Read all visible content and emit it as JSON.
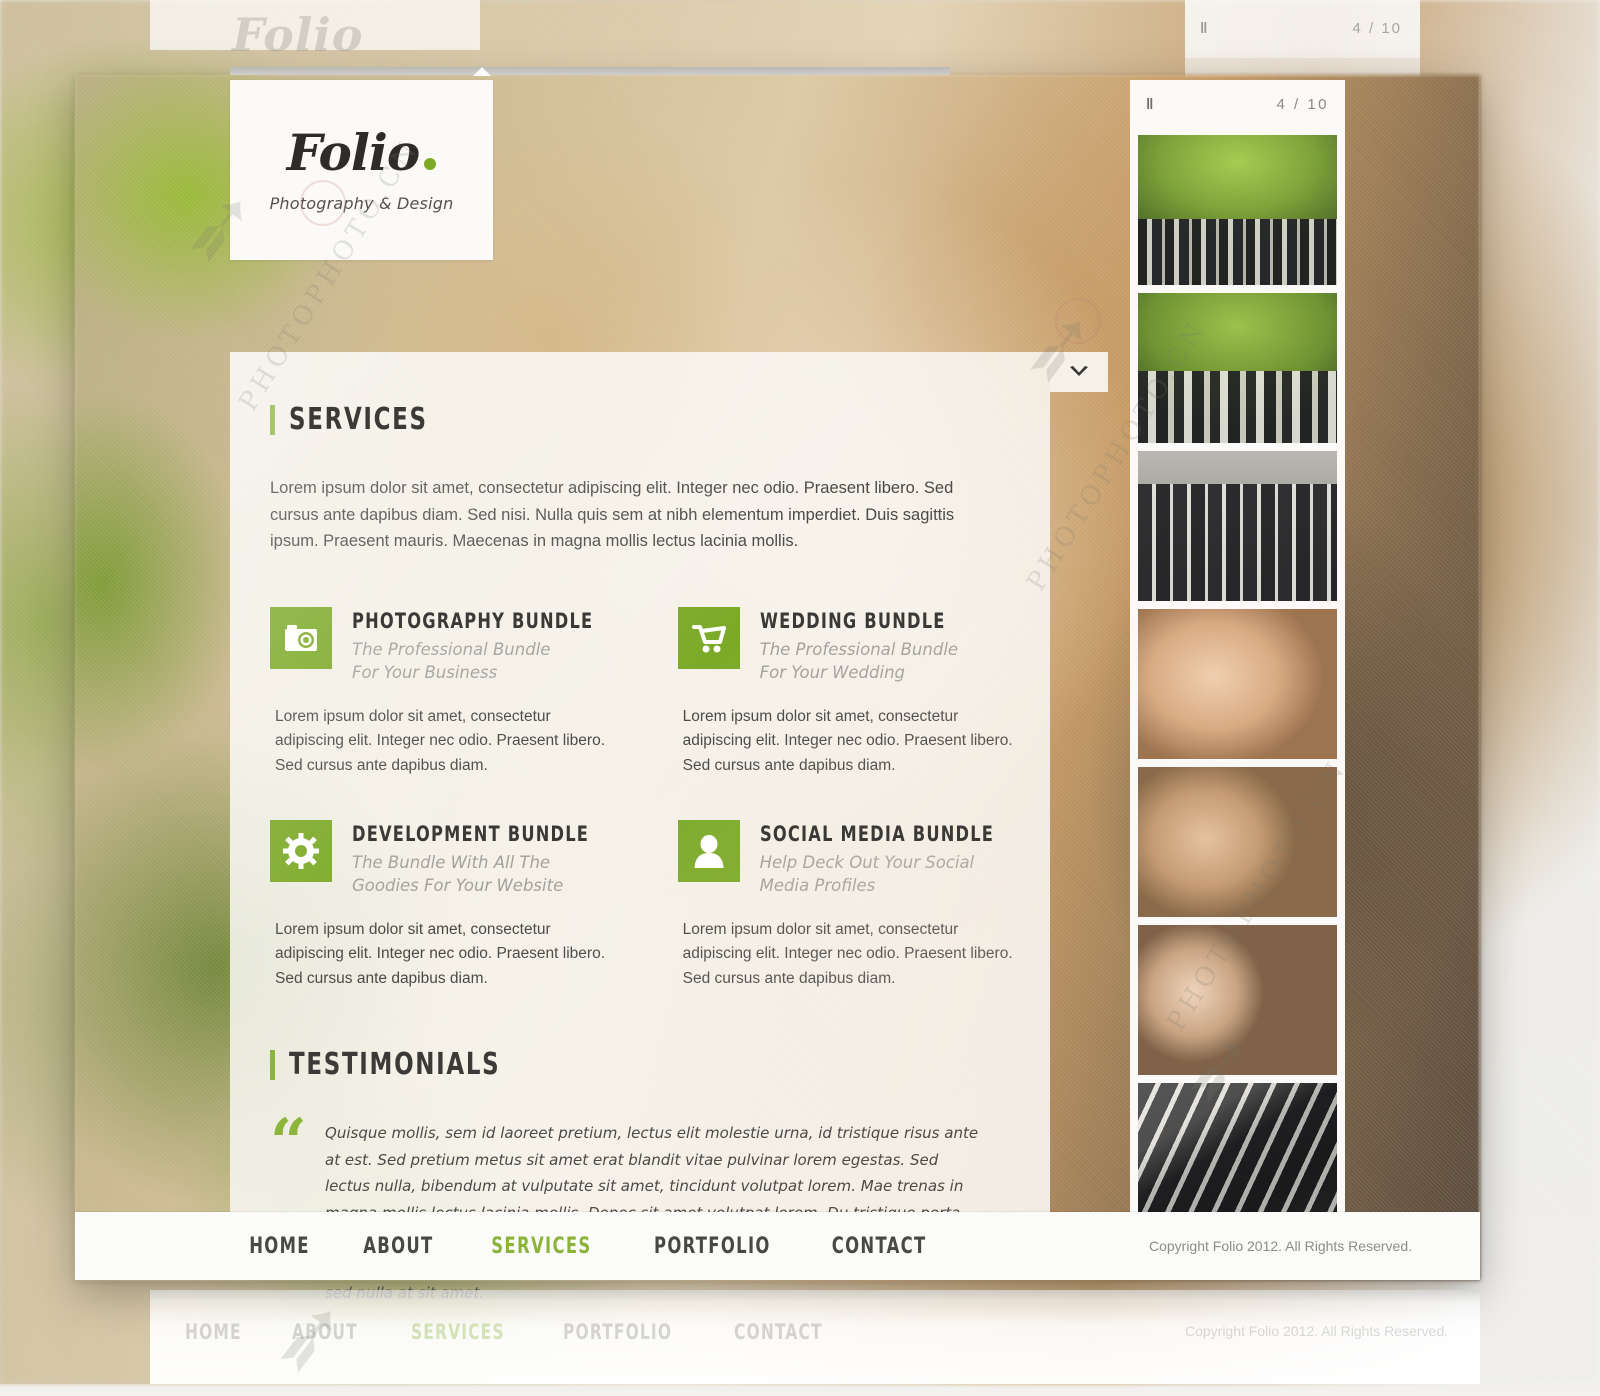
{
  "brand": {
    "name": "Folio",
    "dot": ".",
    "tagline": "Photography & Design"
  },
  "accent_color": "#7caa28",
  "accent_color_light": "#8cb43a",
  "toggle": {
    "icon": "chevron-down-icon"
  },
  "services": {
    "heading": "SERVICES",
    "intro": "Lorem ipsum dolor sit amet, consectetur adipiscing elit. Integer nec odio. Praesent libero. Sed cursus ante dapibus diam. Sed nisi. Nulla quis sem at nibh elementum imperdiet. Duis sagittis ipsum. Praesent mauris. Maecenas in magna mollis lectus lacinia mollis.",
    "bundles": [
      {
        "icon": "camera-icon",
        "title": "PHOTOGRAPHY BUNDLE",
        "tagline": "The Professional Bundle For Your Business",
        "body": "Lorem ipsum dolor sit amet, consectetur adipiscing elit. Integer nec odio. Praesent libero. Sed cursus ante dapibus diam."
      },
      {
        "icon": "shopping-cart-icon",
        "title": "WEDDING BUNDLE",
        "tagline": "The Professional Bundle For Your Wedding",
        "body": "Lorem ipsum dolor sit amet, consectetur adipiscing elit. Integer nec odio. Praesent libero. Sed cursus ante dapibus diam."
      },
      {
        "icon": "gear-icon",
        "title": "DEVELOPMENT BUNDLE",
        "tagline": "The Bundle With All The Goodies For Your Website",
        "body": "Lorem ipsum dolor sit amet, consectetur adipiscing elit. Integer nec odio. Praesent libero. Sed cursus ante dapibus diam."
      },
      {
        "icon": "user-icon",
        "title": "SOCIAL MEDIA BUNDLE",
        "tagline": "Help Deck Out Your Social Media Profiles",
        "body": "Lorem ipsum dolor sit amet, consectetur adipiscing elit. Integer nec odio. Praesent libero. Sed cursus ante dapibus diam."
      }
    ]
  },
  "testimonials": {
    "heading": "TESTIMONIALS",
    "quote_glyph": "“",
    "quote": "Quisque mollis, sem id laoreet pretium, lectus elit molestie urna, id tristique risus ante at est. Sed pretium metus sit amet erat blandit vitae pulvinar lorem egestas. Sed lectus nulla, bibendum at vulputate sit amet, tincidunt volutpat lorem. Mae trenas in magna mollis lectus lacinia mollis. Donec sit amet volutpat lorem. Du tristique porta aliquam. Curabitur sagittis tincidunt erat, quis hendrerit nibh iaculis vitae. Pellentesque ultric nisl quis odio posuere facilisis. In ut felis erat, ac laoreet orci donec sed nulla at sit amet."
  },
  "slider": {
    "pause_icon": "pause-icon",
    "pause_glyph": "‖",
    "counter": "4 / 10",
    "current": 4,
    "total": 10,
    "thumbnails": [
      {
        "alt": "wedding-party-under-trees"
      },
      {
        "alt": "bridal-party-walking-path"
      },
      {
        "alt": "groomsmen-group-portrait"
      },
      {
        "alt": "bride-and-groom-closeup"
      },
      {
        "alt": "couple-forehead-touch"
      },
      {
        "alt": "bride-with-bridesmaids-laughing"
      },
      {
        "alt": "place-cards-detail"
      }
    ]
  },
  "footer": {
    "nav": [
      {
        "label": "HOME",
        "active": false
      },
      {
        "label": "ABOUT",
        "active": false
      },
      {
        "label": "SERVICES",
        "active": true
      },
      {
        "label": "PORTFOLIO",
        "active": false
      },
      {
        "label": "CONTACT",
        "active": false
      }
    ],
    "copyright": "Copyright Folio 2012. All Rights Reserved."
  }
}
